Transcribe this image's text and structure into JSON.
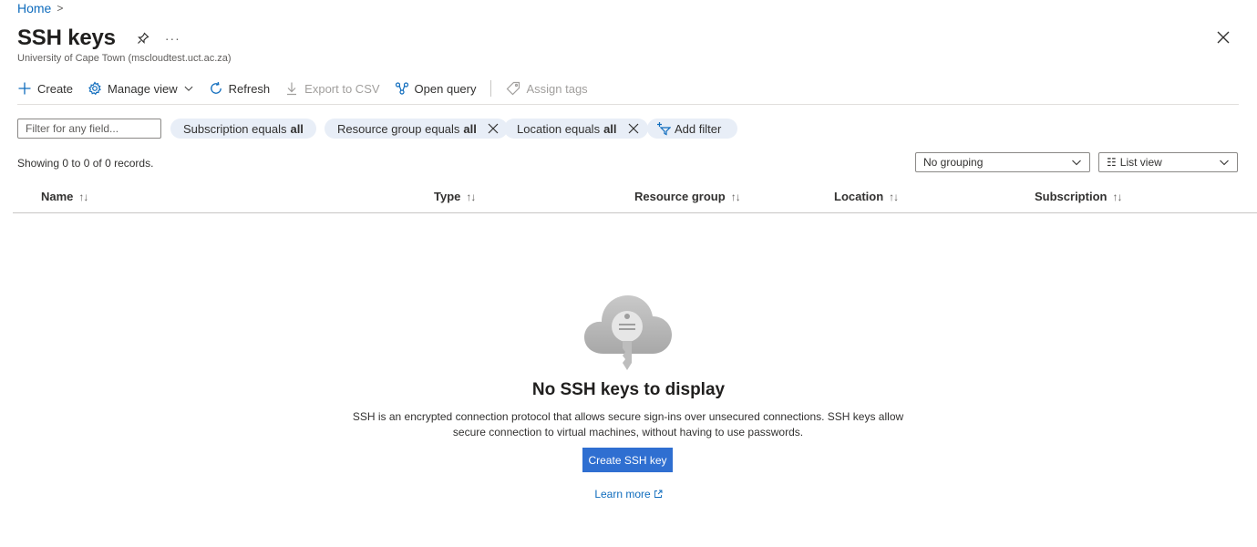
{
  "breadcrumb": {
    "home": "Home",
    "separator": ">"
  },
  "header": {
    "title": "SSH keys",
    "more": "···",
    "subtitle": "University of Cape Town (mscloudtest.uct.ac.za)"
  },
  "toolbar": {
    "create": "Create",
    "manage_view": "Manage view",
    "refresh": "Refresh",
    "export_csv": "Export to CSV",
    "open_query": "Open query",
    "assign_tags": "Assign tags"
  },
  "filters": {
    "search_placeholder": "Filter for any field...",
    "pills": [
      {
        "prefix": "Subscription equals",
        "value": "all"
      },
      {
        "prefix": "Resource group equals",
        "value": "all"
      },
      {
        "prefix": "Location equals",
        "value": "all"
      }
    ],
    "add_filter": "Add filter"
  },
  "records": "Showing 0 to 0 of 0 records.",
  "grouping": {
    "selected": "No grouping"
  },
  "view": {
    "icon": "☷",
    "selected": "List view"
  },
  "columns": [
    {
      "label": "Name",
      "sort": "↑↓"
    },
    {
      "label": "Type",
      "sort": "↑↓"
    },
    {
      "label": "Resource group",
      "sort": "↑↓"
    },
    {
      "label": "Location",
      "sort": "↑↓"
    },
    {
      "label": "Subscription",
      "sort": "↑↓"
    }
  ],
  "empty_state": {
    "icon": "cloud-key-icon",
    "title": "No SSH keys to display",
    "description": "SSH is an encrypted connection protocol that allows secure sign-ins over unsecured connections. SSH keys allow secure connection to virtual machines, without having to use passwords.",
    "button": "Create SSH key",
    "learn_more": "Learn more"
  },
  "colors": {
    "accent": "#2f6fd1",
    "link": "#0f6cbd",
    "pill_bg": "#e8eef7"
  }
}
